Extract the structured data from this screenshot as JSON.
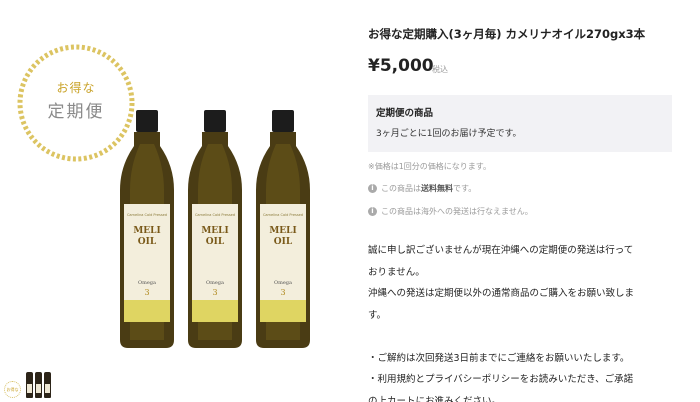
{
  "badge": {
    "line1": "お得な",
    "line2": "定期便",
    "thumb_label": "お得な定期便"
  },
  "product": {
    "title": "お得な定期購入(3ヶ月毎) カメリナオイル270gx3本",
    "price": "¥5,000",
    "tax": "税込"
  },
  "label_text": {
    "top": "Camelina Cold Pressed",
    "brand1": "MELI",
    "brand2": "OIL",
    "jp": "カメリナオイル",
    "omega": "Omega",
    "num": "3"
  },
  "subscription": {
    "heading": "定期便の商品",
    "desc": "3ヶ月ごとに1回のお届け予定です。"
  },
  "notes": {
    "price_note": "※価格は1回分の価格になります。",
    "shipping_pre": "この商品は",
    "shipping_bold": "送料無料",
    "shipping_post": "です。",
    "overseas": "この商品は海外への発送は行なえません。"
  },
  "body": {
    "line1": "誠に申し訳ございませんが現在沖縄への定期便の発送は行って",
    "line2": "おりません。",
    "line3": "沖縄への発送は定期便以外の通常商品のご購入をお願い致しま",
    "line4": "す。",
    "line5": "・ご解約は次回発送3日前までにご連絡をお願いいたします。",
    "line6": "・利用規約とプライバシーポリシーをお読みいただき、ご承諾",
    "line7": "の上カートにお進みください。"
  },
  "colors": {
    "badge_gold": "#c9a227",
    "oil": "#6b5a1a",
    "label_bg": "#f3eedc",
    "flower": "#d8cc3a"
  }
}
